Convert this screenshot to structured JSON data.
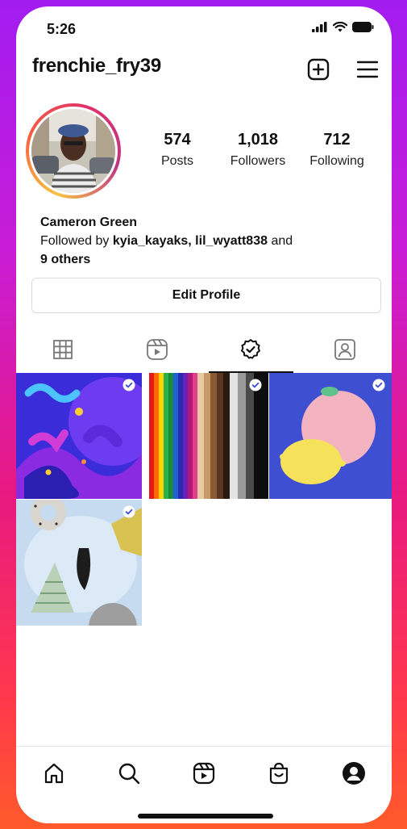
{
  "status_bar": {
    "time": "5:26"
  },
  "header": {
    "username": "frenchie_fry39"
  },
  "profile": {
    "stats": [
      {
        "value": "574",
        "label": "Posts"
      },
      {
        "value": "1,018",
        "label": "Followers"
      },
      {
        "value": "712",
        "label": "Following"
      }
    ],
    "name": "Cameron Green",
    "followed_by_prefix": "Followed by",
    "followed_user_1": "kyia_kayaks",
    "separator": ",",
    "followed_user_2": "lil_wyatt838",
    "and_word": "and",
    "others": "9 others"
  },
  "edit_profile_label": "Edit Profile",
  "tabs": [
    {
      "icon": "grid-icon",
      "active": false
    },
    {
      "icon": "reels-icon",
      "active": false
    },
    {
      "icon": "collectibles-icon",
      "active": true
    },
    {
      "icon": "tagged-icon",
      "active": false
    }
  ],
  "posts": [
    {
      "name": "purple-abstract-post",
      "verified": true
    },
    {
      "name": "rainbow-stripes-post",
      "verified": true
    },
    {
      "name": "citrus-fruit-post",
      "verified": true
    },
    {
      "name": "3d-shapes-post",
      "verified": true
    }
  ],
  "bottom_nav": [
    {
      "icon": "home-icon"
    },
    {
      "icon": "search-icon"
    },
    {
      "icon": "reels-icon"
    },
    {
      "icon": "shop-icon"
    },
    {
      "icon": "profile-icon"
    }
  ],
  "colors": {
    "accent_ring": [
      "#f9c343",
      "#f56040",
      "#e1306c",
      "#c13584"
    ],
    "background_gradient": [
      "#a21cf0",
      "#e8197f",
      "#ff5a2a"
    ]
  }
}
